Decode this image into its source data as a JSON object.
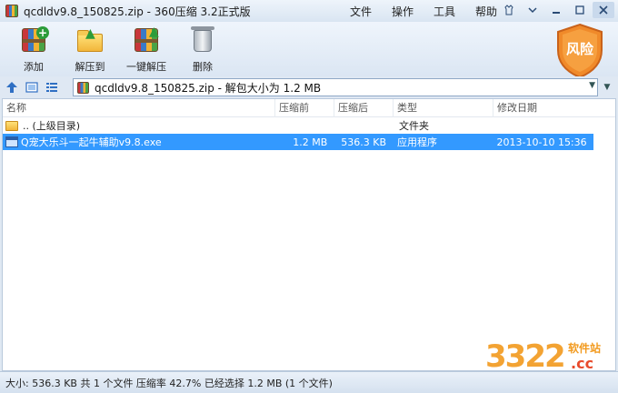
{
  "window": {
    "title": "qcdldv9.8_150825.zip - 360压缩 3.2正式版",
    "menu": [
      "文件",
      "操作",
      "工具",
      "帮助"
    ]
  },
  "toolbar": {
    "add_label": "添加",
    "extract_to_label": "解压到",
    "one_click_label": "一键解压",
    "delete_label": "删除"
  },
  "risk_badge": {
    "label": "风险",
    "color": "#e8731f"
  },
  "address": {
    "path_text": "qcdldv9.8_150825.zip - 解包大小为 1.2 MB"
  },
  "columns": [
    "名称",
    "压缩前",
    "压缩后",
    "类型",
    "修改日期"
  ],
  "rows": [
    {
      "name": ".. (上级目录)",
      "size": "",
      "packed": "",
      "type": "文件夹",
      "modified": ""
    },
    {
      "name": "Q宠大乐斗一起牛辅助v9.8.exe",
      "size": "1.2 MB",
      "packed": "536.3 KB",
      "type": "应用程序",
      "modified": "2013-10-10 15:36"
    }
  ],
  "status": {
    "text": "大小: 536.3 KB 共 1 个文件 压缩率 42.7% 已经选择 1.2 MB (1 个文件)"
  },
  "watermark": {
    "number": "3322",
    "site": "软件站",
    "domain": ".cc"
  },
  "colors": {
    "selection": "#3399ff",
    "accent": "#2f6fc3"
  }
}
